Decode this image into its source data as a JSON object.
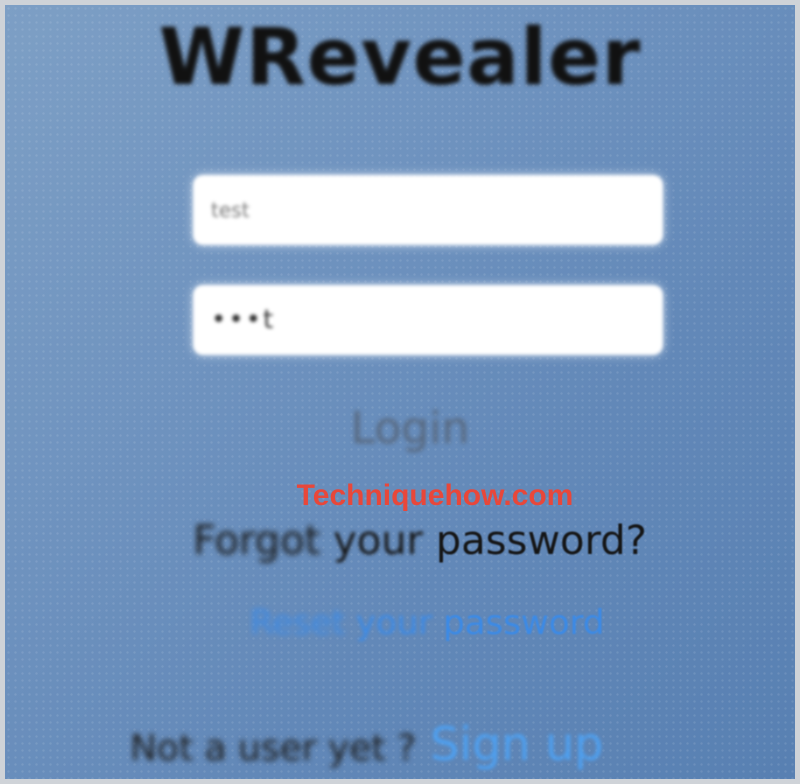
{
  "app": {
    "title": "WRevealer"
  },
  "form": {
    "username_value": "test",
    "password_value": "•••t",
    "login_label": "Login"
  },
  "watermark": {
    "text": "Techniquehow.com"
  },
  "forgot": {
    "word1": "Forgot",
    "word2": "your",
    "word3": "password?"
  },
  "reset": {
    "word1": "Reset",
    "word2": "your",
    "word3": "password"
  },
  "signup": {
    "prompt": "Not a user yet ?",
    "link_label": "Sign up"
  },
  "colors": {
    "background": "#6f93bf",
    "link": "#4ea0f0",
    "watermark": "#e8473a"
  }
}
